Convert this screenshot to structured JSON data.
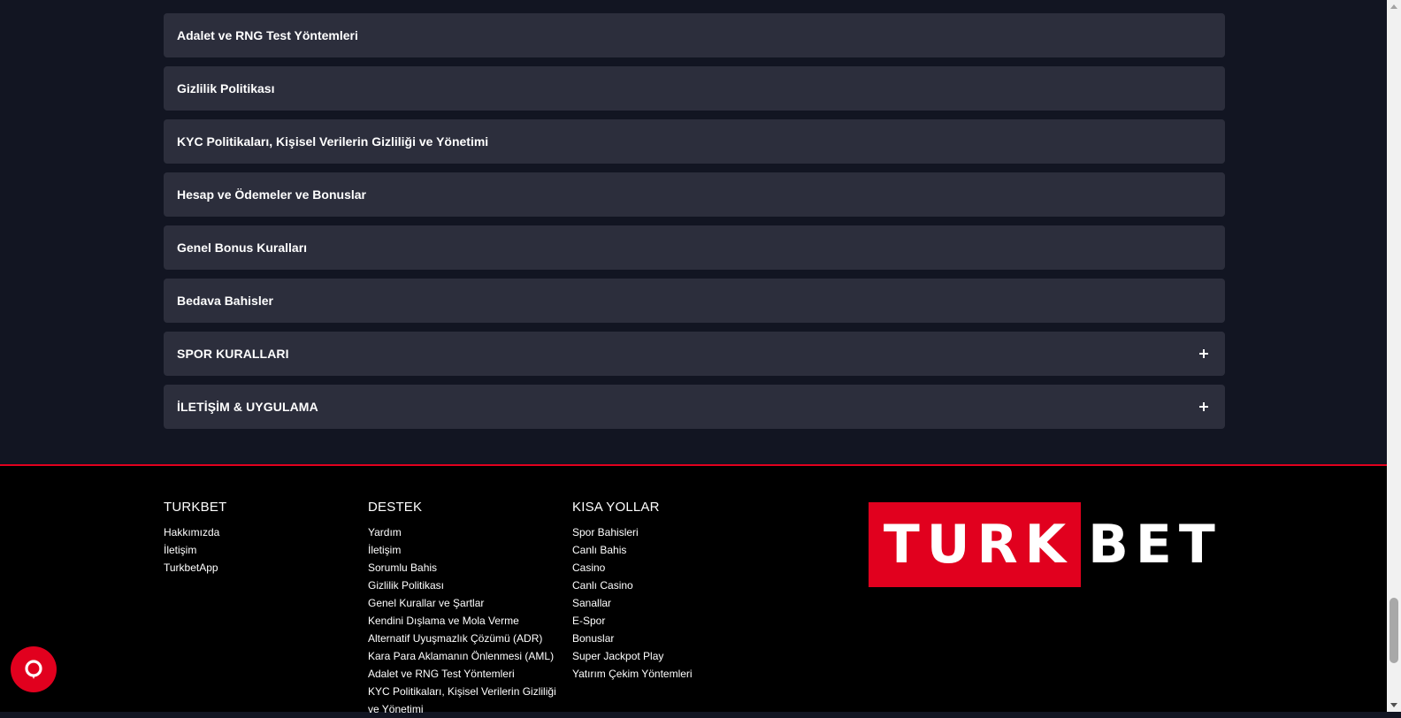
{
  "accordion": {
    "items": [
      {
        "label": "Adalet ve RNG Test Yöntemleri"
      },
      {
        "label": "Gizlilik Politikası"
      },
      {
        "label": "KYC Politikaları, Kişisel Verilerin Gizliliği ve Yönetimi"
      },
      {
        "label": "Hesap ve Ödemeler ve Bonuslar"
      },
      {
        "label": "Genel Bonus Kuralları"
      },
      {
        "label": "Bedava Bahisler"
      }
    ],
    "sections": [
      {
        "label": "SPOR KURALLARI"
      },
      {
        "label": "İLETİŞİM & UYGULAMA"
      }
    ]
  },
  "footer": {
    "columns": [
      {
        "title": "TURKBET",
        "links": [
          "Hakkımızda",
          "İletişim",
          "TurkbetApp"
        ]
      },
      {
        "title": "DESTEK",
        "links": [
          "Yardım",
          "İletişim",
          "Sorumlu Bahis",
          "Gizlilik Politikası",
          "Genel Kurallar ve Şartlar",
          "Kendini Dışlama ve Mola Verme",
          "Alternatif Uyuşmazlık Çözümü (ADR)",
          "Kara Para Aklamanın Önlenmesi (AML)",
          "Adalet ve RNG Test Yöntemleri",
          "KYC Politikaları, Kişisel Verilerin Gizliliği ve Yönetimi"
        ]
      },
      {
        "title": "KISA YOLLAR",
        "links": [
          "Spor Bahisleri",
          "Canlı Bahis",
          "Casino",
          "Canlı Casino",
          "Sanallar",
          "E-Spor",
          "Bonuslar",
          "Super Jackpot Play",
          "Yatırım Çekim Yöntemleri"
        ]
      }
    ],
    "logo": {
      "part1": "TURK",
      "part2": "BET"
    }
  },
  "colors": {
    "accent": "#e1001e",
    "panel": "#2c2e3c",
    "background": "#121522"
  },
  "icons": {
    "section_toggle": "plus-icon",
    "chat": "chat-bubble-icon"
  }
}
